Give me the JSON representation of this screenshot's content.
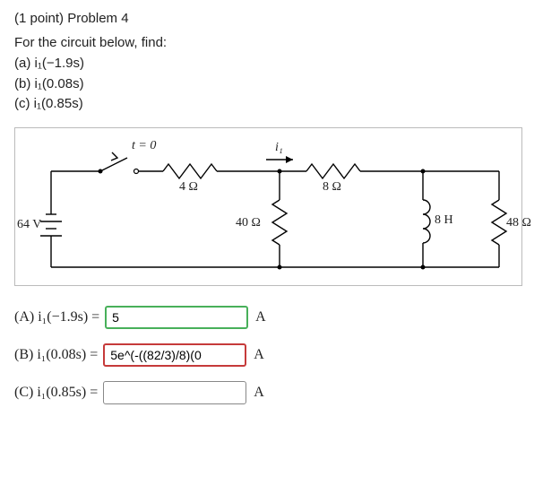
{
  "header": "(1 point) Problem 4",
  "prompt": "For the circuit below, find:",
  "parts": {
    "a": "(a) i₁(−1.9s)",
    "b": "(b) i₁(0.08s)",
    "c": "(c) i₁(0.85s)"
  },
  "circuit": {
    "t0": "t = 0",
    "i1": "i₁",
    "r4": "4 Ω",
    "r8": "8 Ω",
    "r40": "40 Ω",
    "h8": "8 H",
    "r48": "48 Ω",
    "v64": "64 V"
  },
  "answers": {
    "A": {
      "label": "(A) i₁(−1.9s) = ",
      "value": "5",
      "unit": "A",
      "state": "correct"
    },
    "B": {
      "label": "(B) i₁(0.08s) = ",
      "value": "5e^(-((82/3)/8)(0",
      "unit": "A",
      "state": "incorrect"
    },
    "C": {
      "label": "(C) i₁(0.85s) = ",
      "value": "",
      "unit": "A",
      "state": "blank"
    }
  }
}
